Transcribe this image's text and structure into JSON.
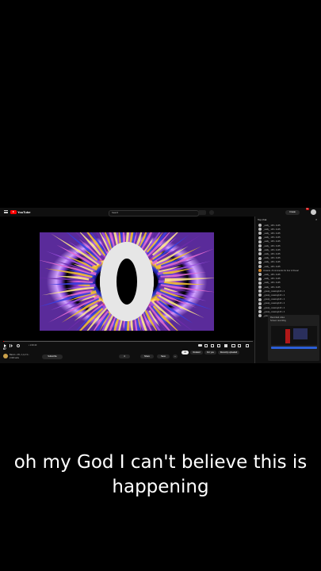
{
  "topbar": {
    "logo_text": "YouTube",
    "search_placeholder": "Search",
    "create_label": "Create",
    "notification_count": "9+"
  },
  "player": {
    "countdown_digit": "0",
    "time_display": "• 1:00:43",
    "progress_fraction": 0.003
  },
  "video": {
    "title": "67",
    "channel_name": "Bacon • 2%, 1,4,2 3 •",
    "subscribers": "2.3M subs",
    "subscribe_label": "Subscribe",
    "like_count": "4",
    "share_label": "Share",
    "save_label": "Save"
  },
  "filters": [
    "All",
    "Related",
    "For you",
    "Recently uploaded"
  ],
  "chat": {
    "header": "Top chat",
    "rows": [
      "_wally_ 145 • 1145",
      "_wally_ 145 • 1145",
      "_wally_ 145 • 1145",
      "_wally_ 145 • 1145",
      "_wally_ 145 • 1145",
      "_wally_ 145 • 1145",
      "_wally_ 145 • 1145",
      "_wally_ 145 • 1145",
      "_wally_ 145 • 1145",
      "_wally_ 145 • 1145",
      "_wally_ 145 • 1145",
      "Jovanie • 8 comments for four of these!",
      "_wally_ 145 • 1145",
      "_wally_ 145 • 1145",
      "_wally_ 145 • 1145",
      "_wally_ 145 • 1145",
      "_greaty_ceasing123 • 4",
      "_greaty_ceasing123 • 4",
      "_greaty_ceasing123 • 4",
      "_greaty_ceasing123 • 4",
      "_greaty_ceasing123 • 4",
      "_greaty_ceasing123 • 4",
      "_greaty_ceasing123 • 4"
    ]
  },
  "mini_player": {
    "title": "Recorded video",
    "subtitle": "Screen recording"
  },
  "caption": "oh my God I can't believe this is happening",
  "colors": {
    "background": "#000000",
    "yt_red": "#ff0000",
    "caption": "#ffffff"
  }
}
